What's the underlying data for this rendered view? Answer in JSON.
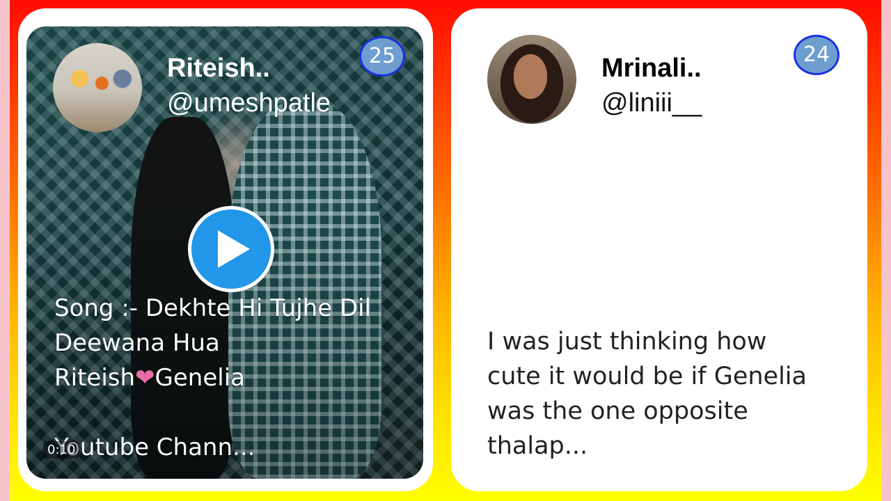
{
  "colors": {
    "gradient_top": "#ff0d00",
    "gradient_bottom": "#ffff00",
    "badge_fill": "#6e9ed0",
    "badge_border": "#1a30e0",
    "play_button": "#2296e8",
    "heart": "#e86aa6"
  },
  "left_card": {
    "name": "Riteish..",
    "handle": "@umeshpatle",
    "badge": "25",
    "play_icon": "play-icon",
    "timer": "0:10",
    "caption": {
      "line1": "Song :- Dekhte Hi Tujhe Dil",
      "line2": "Deewana Hua",
      "line3_a": "Riteish",
      "line3_heart": "❤",
      "line3_b": "Genelia",
      "line4": "",
      "line5": "Youtube Chann..."
    }
  },
  "right_card": {
    "name": "Mrinali..",
    "handle": "@liniii__",
    "badge": "24",
    "text": {
      "line1": "I was just thinking how",
      "line2": "cute it would be if Genelia",
      "line3": "was the one opposite",
      "line4": "thalap..."
    }
  }
}
